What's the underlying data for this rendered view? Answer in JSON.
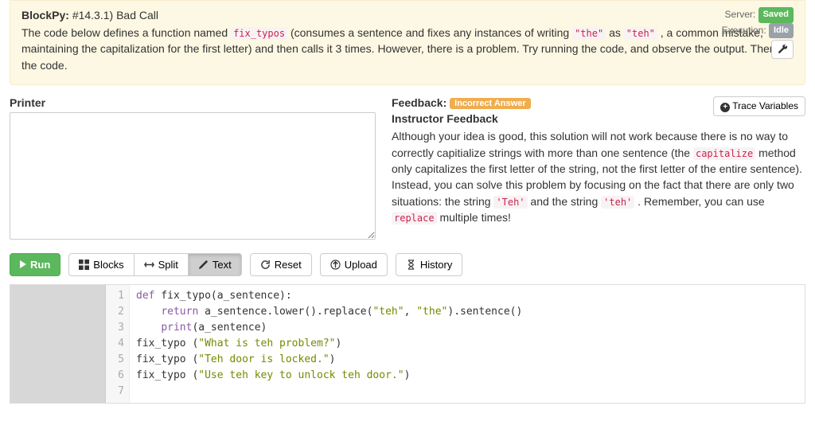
{
  "header": {
    "app": "BlockPy:",
    "problem_id": "#14.3.1) Bad Call",
    "description_pre": "The code below defines a function named ",
    "description_code1": "fix_typos",
    "description_mid1": " (consumes a sentence and fixes any instances of writing ",
    "description_code2": "\"the\"",
    "description_mid2": " as ",
    "description_code3": "\"teh\"",
    "description_mid3": " , a common mistake, maintaining the capitalization for the first letter) and then calls it 3 times. However, there is a problem. Try running the code, and observe the output. Then, fix the code."
  },
  "status": {
    "server_label": "Server:",
    "server_badge": "Saved",
    "exec_label": "Execution:",
    "exec_badge": "Idle"
  },
  "printer": {
    "title": "Printer",
    "value": ""
  },
  "feedback": {
    "label": "Feedback:",
    "badge": "Incorrect Answer",
    "subtitle": "Instructor Feedback",
    "body_pre": "Although your idea is good, this solution will not work because there is no way to correctly capitialize strings with more than one sentence (the ",
    "code1": "capitalize",
    "body_mid1": " method only capitalizes the first letter of the string, not the first letter of the entire sentence). Instead, you can solve this problem by focusing on the fact that there are only two situations: the string ",
    "code2": "'Teh'",
    "body_mid2": " and the string ",
    "code3": "'teh'",
    "body_mid3": " . Remember, you can use ",
    "code4": "replace",
    "body_post": " multiple times!",
    "trace_btn": "Trace Variables"
  },
  "toolbar": {
    "run": "Run",
    "blocks": "Blocks",
    "split": "Split",
    "text": "Text",
    "reset": "Reset",
    "upload": "Upload",
    "history": "History"
  },
  "code": {
    "lines": [
      {
        "n": "1",
        "raw": "def fix_typo(a_sentence):"
      },
      {
        "n": "2",
        "raw": "    return a_sentence.lower().replace(\"teh\", \"the\").sentence()"
      },
      {
        "n": "3",
        "raw": "    print(a_sentence)"
      },
      {
        "n": "4",
        "raw": "fix_typo (\"What is teh problem?\")"
      },
      {
        "n": "5",
        "raw": "fix_typo (\"Teh door is locked.\")"
      },
      {
        "n": "6",
        "raw": "fix_typo (\"Use teh key to unlock teh door.\")"
      },
      {
        "n": "7",
        "raw": ""
      }
    ]
  }
}
